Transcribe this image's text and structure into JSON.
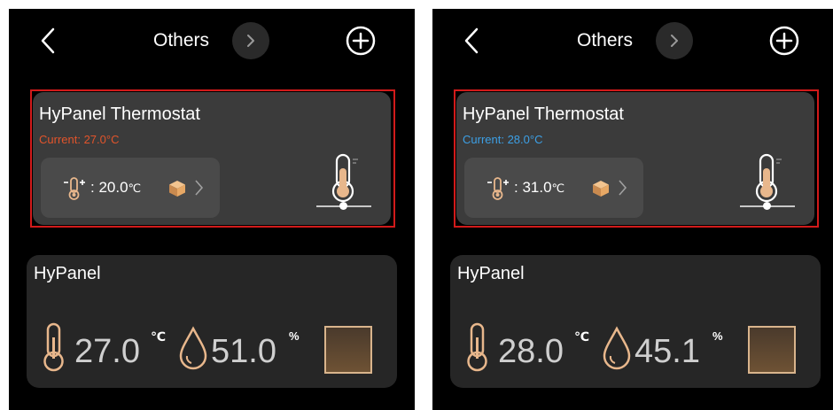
{
  "colors": {
    "current_warm": "#e2542b",
    "current_cool": "#3ca0e6",
    "icon_gold": "#e8b78c",
    "highlight": "#d11a1a"
  },
  "screens": [
    {
      "header": {
        "title": "Others"
      },
      "thermostat": {
        "name": "HyPanel Thermostat",
        "current": "Current: 27.0°C",
        "current_color": "warm",
        "setpoint": ": 20.0",
        "setpoint_unit": "℃",
        "slider_fraction": 0.5
      },
      "hypanel": {
        "name": "HyPanel",
        "temperature": "27.0",
        "temperature_unit": "℃",
        "humidity": "51.0",
        "humidity_unit": "%"
      }
    },
    {
      "header": {
        "title": "Others"
      },
      "thermostat": {
        "name": "HyPanel Thermostat",
        "current": "Current: 28.0°C",
        "current_color": "cool",
        "setpoint": ": 31.0",
        "setpoint_unit": "℃",
        "slider_fraction": 0.5
      },
      "hypanel": {
        "name": "HyPanel",
        "temperature": "28.0",
        "temperature_unit": "℃",
        "humidity": "45.1",
        "humidity_unit": "%"
      }
    }
  ]
}
